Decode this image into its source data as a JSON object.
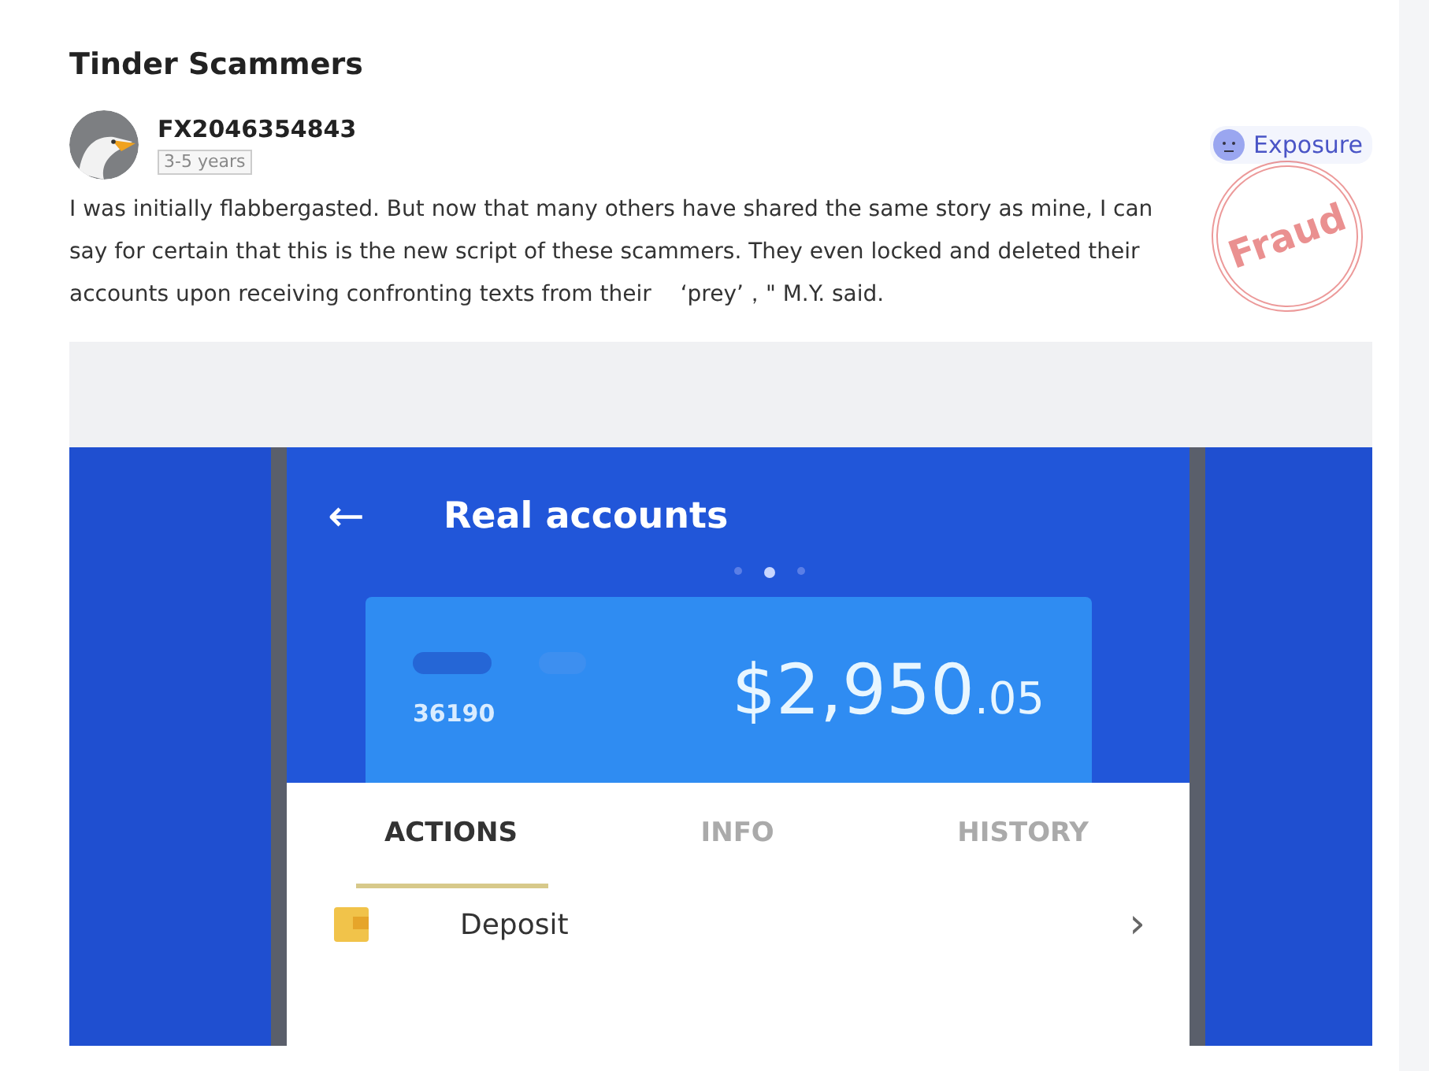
{
  "post": {
    "title": "Tinder Scammers",
    "author": {
      "name": "FX2046354843",
      "tenure": "3-5 years"
    },
    "category": {
      "label": "Exposure"
    },
    "stamp": {
      "label": "Fraud"
    },
    "body": "I was initially flabbergasted. But now that many others have shared the same story as mine, I can say for certain that this is the new script of these scammers. They even locked and deleted their accounts upon receiving confronting texts from their 　‘prey’，\" M.Y. said."
  },
  "app_screenshot": {
    "header": {
      "back": "←",
      "title": "Real accounts"
    },
    "pager": [
      {
        "selected": false
      },
      {
        "selected": true
      },
      {
        "selected": false
      }
    ],
    "account": {
      "number": "36190",
      "amount": "$2,950",
      "cents": ".05"
    },
    "tabs": [
      {
        "label": "ACTIONS",
        "selected": true
      },
      {
        "label": "INFO",
        "selected": false
      },
      {
        "label": "HISTORY",
        "selected": false
      }
    ],
    "actions": [
      {
        "label": "Deposit",
        "chevron": "›"
      }
    ]
  }
}
